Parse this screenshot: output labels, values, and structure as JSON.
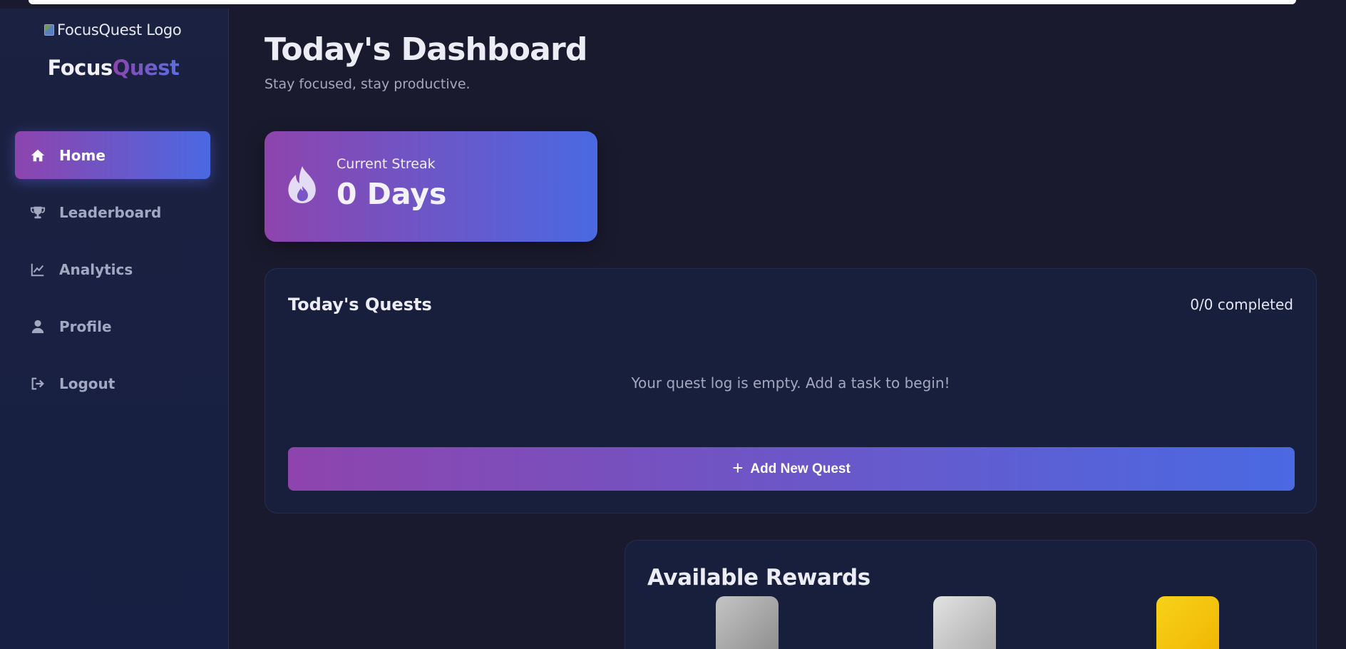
{
  "sidebar": {
    "logo_alt": "FocusQuest Logo",
    "brand_part1": "Focus",
    "brand_part2": "Quest",
    "items": [
      {
        "label": "Home",
        "icon": "home-icon",
        "active": true
      },
      {
        "label": "Leaderboard",
        "icon": "trophy-icon",
        "active": false
      },
      {
        "label": "Analytics",
        "icon": "chart-line-icon",
        "active": false
      },
      {
        "label": "Profile",
        "icon": "user-icon",
        "active": false
      },
      {
        "label": "Logout",
        "icon": "logout-icon",
        "active": false
      }
    ]
  },
  "header": {
    "title": "Today's Dashboard",
    "subtitle": "Stay focused, stay productive."
  },
  "streak": {
    "label": "Current Streak",
    "value": "0 Days",
    "icon": "fire-icon"
  },
  "quests": {
    "title": "Today's Quests",
    "count": "0/0 completed",
    "empty_message": "Your quest log is empty. Add a task to begin!",
    "add_button_label": "Add New Quest"
  },
  "rewards": {
    "title": "Available Rewards"
  },
  "colors": {
    "background": "#1a1a2e",
    "sidebar": "#172042",
    "card": "#181f3d",
    "gradient_start": "#8e44ad",
    "gradient_end": "#4a69e2",
    "muted_text": "#a4a8bf"
  }
}
